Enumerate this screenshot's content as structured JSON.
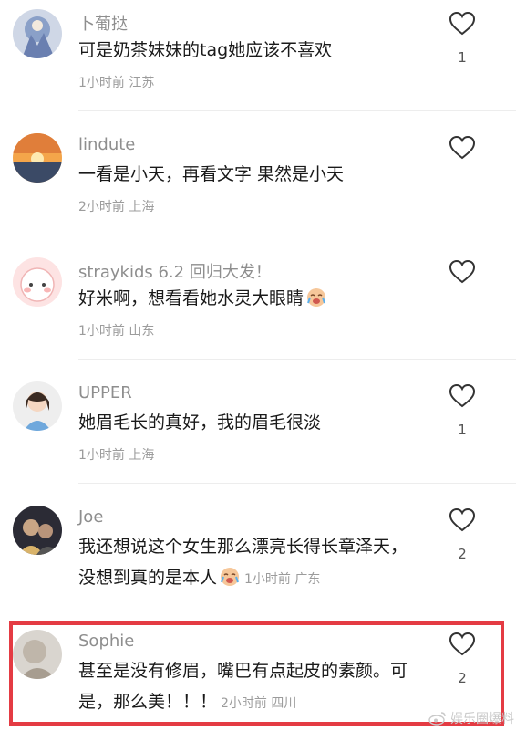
{
  "comments": [
    {
      "username": "卜葡挞",
      "text": "可是奶茶妹妹的tag她应该不喜欢",
      "time": "1小时前",
      "location": "江苏",
      "likes": "1"
    },
    {
      "username": "lindute",
      "text": "一看是小天，再看文字  果然是小天",
      "time": "2小时前",
      "location": "上海",
      "likes": ""
    },
    {
      "username": "straykids 6.2 回归大发！",
      "text": "好米啊，想看看她水灵大眼睛",
      "time": "1小时前",
      "location": "山东",
      "likes": ""
    },
    {
      "username": "UPPER",
      "text": "她眉毛长的真好，我的眉毛很淡",
      "time": "1小时前",
      "location": "上海",
      "likes": "1"
    },
    {
      "username": "Joe",
      "text": "我还想说这个女生那么漂亮长得长章泽天，没想到真的是本人",
      "time": "1小时前",
      "location": "广东",
      "likes": "2"
    },
    {
      "username": "Sophie",
      "text": "甚至是没有修眉，嘴巴有点起皮的素颜。可是，那么美！！！",
      "time": "2小时前",
      "location": "四川",
      "likes": "2"
    }
  ],
  "icons": {
    "like": "heart-outline-icon",
    "emoji": "crying-face-emoji"
  },
  "colors": {
    "highlight": "#e43b43"
  },
  "watermark": "娱乐圈爆料"
}
